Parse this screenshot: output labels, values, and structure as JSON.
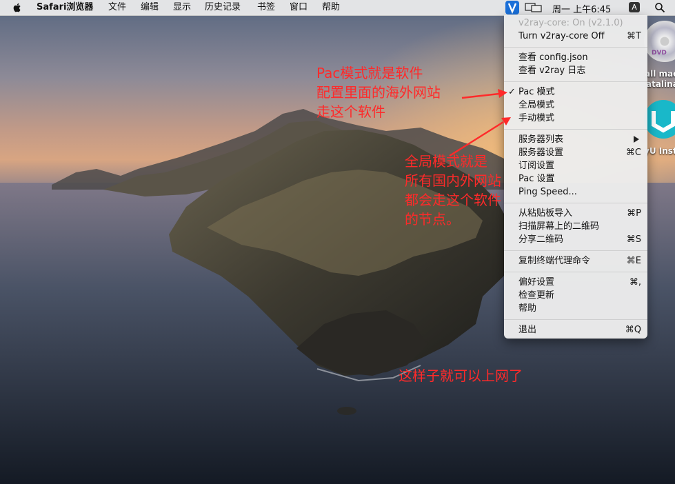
{
  "menubar": {
    "app_name": "Safari浏览器",
    "items": [
      "文件",
      "编辑",
      "显示",
      "历史记录",
      "书签",
      "窗口",
      "帮助"
    ],
    "clock": "周一 上午6:45",
    "input_source": "A"
  },
  "desktop_icons": {
    "dvd_label": "DVD",
    "dvd_caption_line1": "all mac",
    "dvd_caption_line2": "atalina",
    "app_caption": "yU Inst"
  },
  "menu": {
    "status": "v2ray-core: On  (v2.1.0)",
    "toggle_core": {
      "label": "Turn v2ray-core Off",
      "shortcut": "⌘T"
    },
    "view_config": "查看 config.json",
    "view_log": "查看 v2ray 日志",
    "pac_mode": "Pac 模式",
    "global_mode": "全局模式",
    "manual_mode": "手动模式",
    "server_list": "服务器列表",
    "server_settings": {
      "label": "服务器设置",
      "shortcut": "⌘C"
    },
    "subscription_settings": "订阅设置",
    "pac_settings": "Pac 设置",
    "ping_speed": "Ping Speed...",
    "import_clipboard": {
      "label": "从粘贴板导入",
      "shortcut": "⌘P"
    },
    "scan_qr": "扫描屏幕上的二维码",
    "share_qr": {
      "label": "分享二维码",
      "shortcut": "⌘S"
    },
    "copy_proxy_cmd": {
      "label": "复制终端代理命令",
      "shortcut": "⌘E"
    },
    "preferences": {
      "label": "偏好设置",
      "shortcut": "⌘,"
    },
    "check_updates": "检查更新",
    "help": "帮助",
    "quit": {
      "label": "退出",
      "shortcut": "⌘Q"
    },
    "selected_mode": "pac"
  },
  "annotations": {
    "pac_note": [
      "Pac模式就是软件",
      "配置里面的海外网站",
      "走这个软件"
    ],
    "global_note": [
      "全局模式就是",
      "所有国内外网站",
      "都会走这个软件",
      "的节点。"
    ],
    "done_note": "这样子就可以上网了",
    "color": "#ff2a2a"
  }
}
